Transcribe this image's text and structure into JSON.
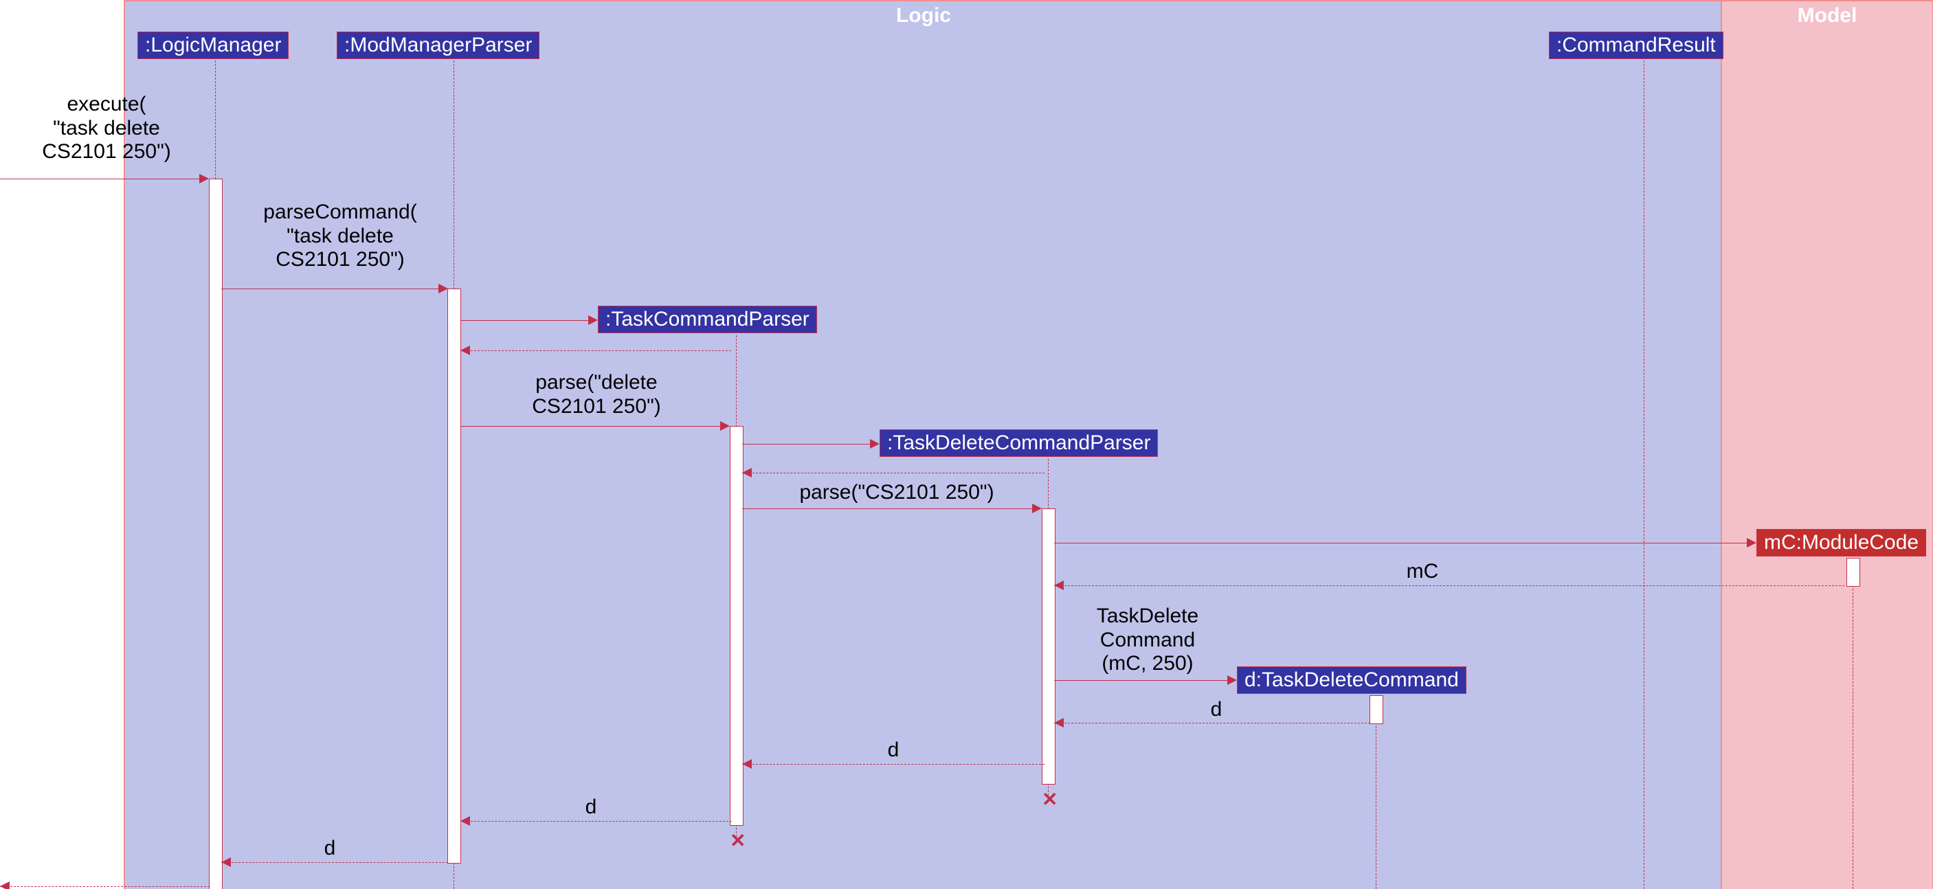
{
  "frames": {
    "logic": "Logic",
    "model": "Model"
  },
  "participants": {
    "logicManager": ":LogicManager",
    "modManagerParser": ":ModManagerParser",
    "taskCommandParser": ":TaskCommandParser",
    "taskDeleteCommandParser": ":TaskDeleteCommandParser",
    "commandResult": ":CommandResult",
    "moduleCode": "mC:ModuleCode",
    "taskDeleteCommand": "d:TaskDeleteCommand"
  },
  "messages": {
    "execute": "execute(\n\"task delete\nCS2101 250\")",
    "parseCommand": "parseCommand(\n\"task delete\nCS2101 250\")",
    "parseDelete": "parse(\"delete\nCS2101 250\")",
    "parseArgs": "parse(\"CS2101 250\")",
    "mC": "mC",
    "taskDeleteCtor": "TaskDelete\nCommand\n(mC, 250)",
    "d": "d"
  }
}
